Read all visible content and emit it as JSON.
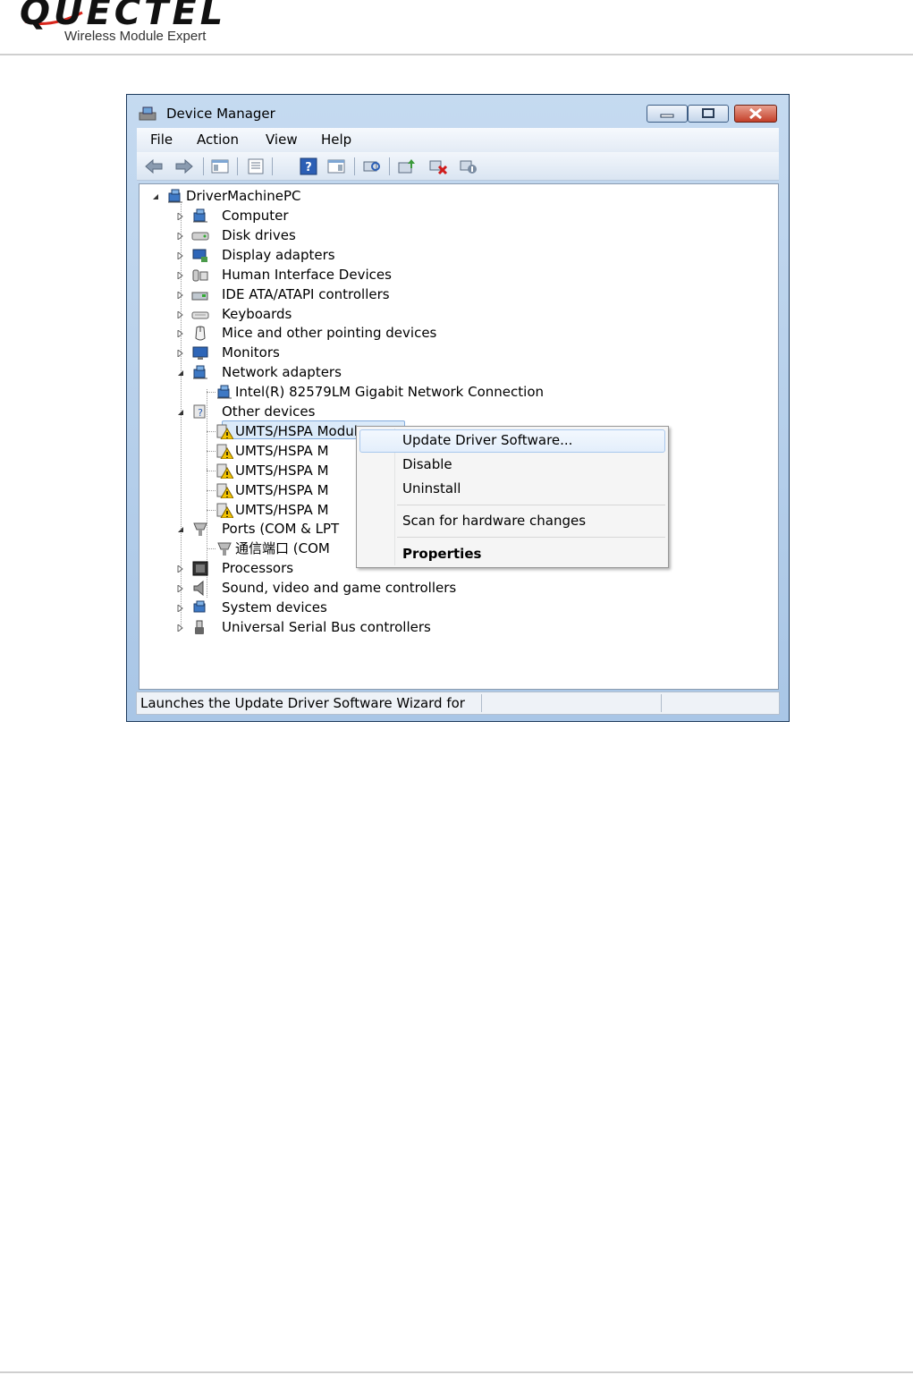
{
  "header": {
    "logo_text": "QUECTEL",
    "tagline": "Wireless Module Expert"
  },
  "window": {
    "title": "Device Manager",
    "menu": [
      "File",
      "Action",
      "View",
      "Help"
    ],
    "tree": {
      "root": "DriverMachinePC",
      "items": [
        "Computer",
        "Disk drives",
        "Display adapters",
        "Human Interface Devices",
        "IDE ATA/ATAPI controllers",
        "Keyboards",
        "Mice and other pointing devices",
        "Monitors",
        "Network adapters",
        "Intel(R) 82579LM Gigabit Network Connection",
        "Other devices",
        "UMTS/HSPA M",
        "UMTS/HSPA M",
        "UMTS/HSPA M",
        "UMTS/HSPA M",
        "UMTS/HSPA M",
        "Ports (COM & LPT",
        "通信端口 (COM",
        "Processors",
        "Sound, video and game controllers",
        "System devices",
        "Universal Serial Bus controllers"
      ],
      "selected_partial": "odule"
    },
    "status_text": "Launches the Update Driver Software Wizard for"
  },
  "context_menu": {
    "items": [
      "Update Driver Software...",
      "Disable",
      "Uninstall",
      "Scan for hardware changes",
      "Properties"
    ]
  },
  "colors": {
    "titlebar": "#b7cfea",
    "selection": "#dbeaf9",
    "close_button": "#c4402a",
    "warning": "#f2c200"
  }
}
